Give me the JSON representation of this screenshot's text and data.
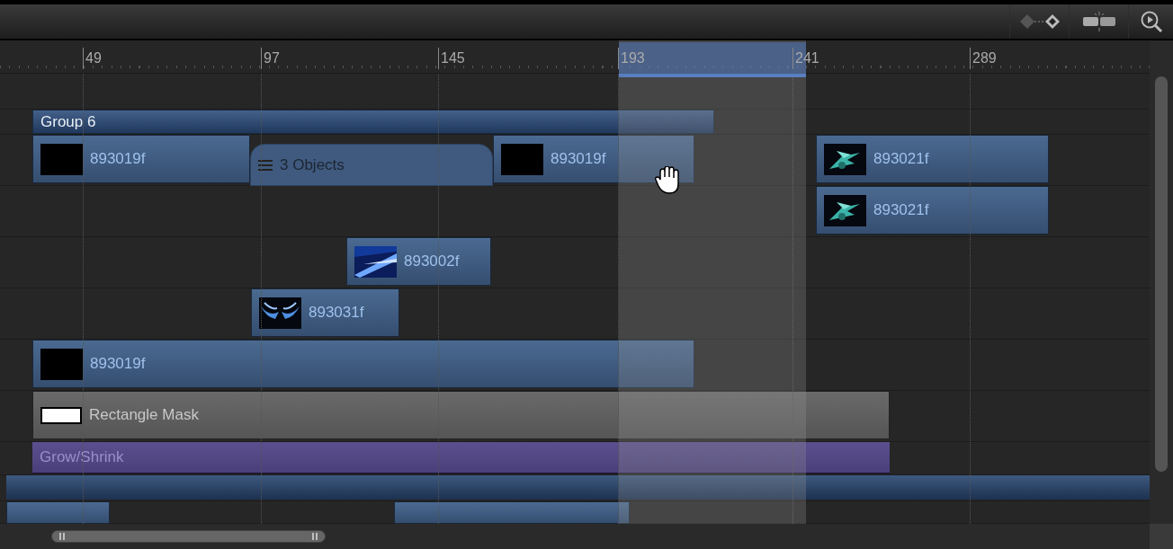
{
  "ruler": {
    "ticks": [
      "49",
      "97",
      "145",
      "193",
      "241",
      "289"
    ]
  },
  "tracks": [
    {
      "clips": [
        {
          "kind": "group",
          "label": "Group 6"
        }
      ]
    },
    {
      "clips": [
        {
          "kind": "media",
          "label": "893019f"
        },
        {
          "kind": "collapsed",
          "label": "3 Objects"
        },
        {
          "kind": "media",
          "label": "893019f"
        },
        {
          "kind": "media",
          "label": "893021f"
        }
      ]
    },
    {
      "clips": [
        {
          "kind": "media",
          "label": "893021f"
        }
      ]
    },
    {
      "clips": [
        {
          "kind": "media",
          "label": "893002f"
        }
      ]
    },
    {
      "clips": [
        {
          "kind": "media",
          "label": "893031f"
        }
      ]
    },
    {
      "clips": [
        {
          "kind": "media",
          "label": "893019f"
        }
      ]
    },
    {
      "clips": [
        {
          "kind": "mask",
          "label": "Rectangle Mask"
        }
      ]
    },
    {
      "clips": [
        {
          "kind": "behavior",
          "label": "Grow/Shrink"
        }
      ]
    },
    {
      "clips": [
        {
          "kind": "band"
        }
      ]
    },
    {
      "clips": [
        {
          "kind": "media"
        },
        {
          "kind": "media"
        }
      ]
    }
  ]
}
